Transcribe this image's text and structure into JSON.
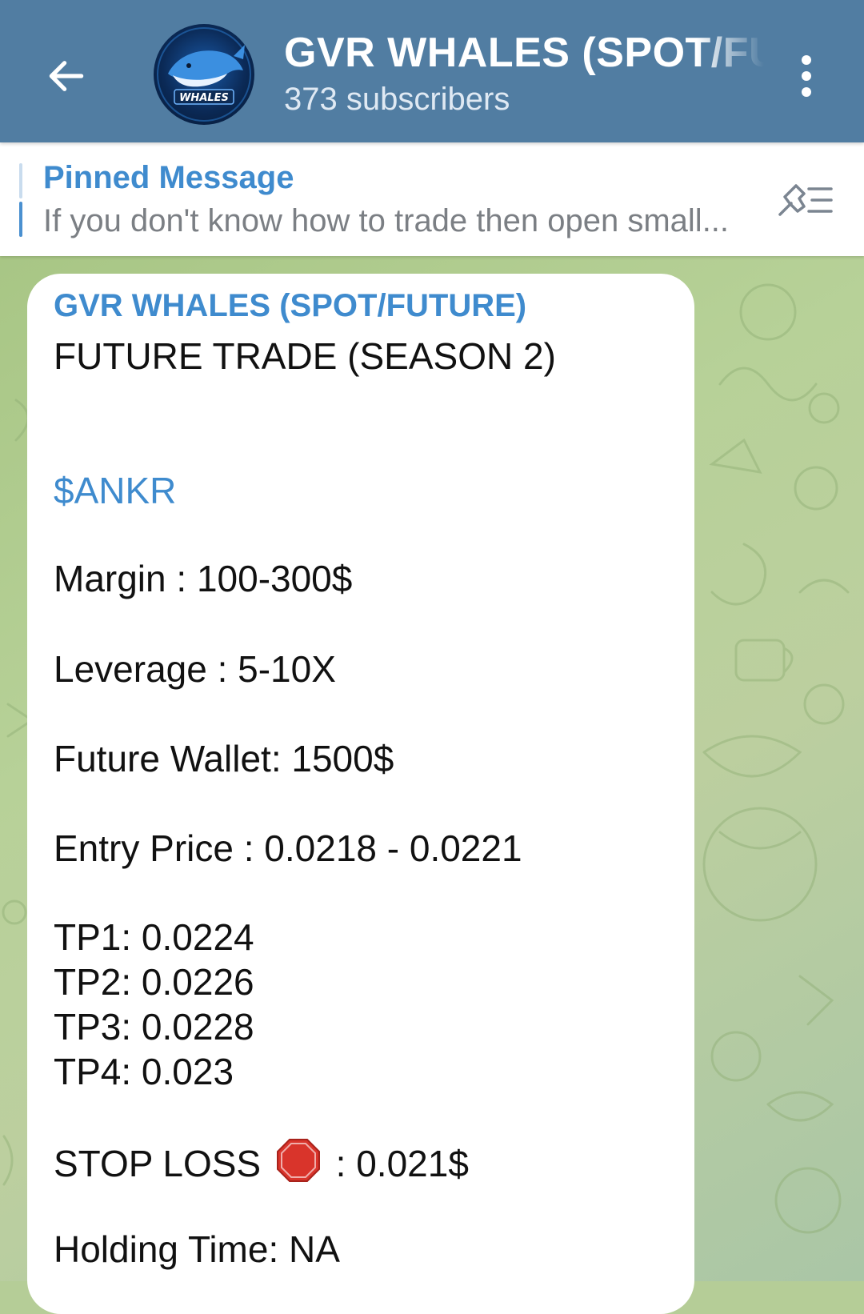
{
  "header": {
    "title": "GVR WHALES (SPOT/FUTURE)",
    "subtitle": "373 subscribers",
    "avatar_text": "WHALES"
  },
  "pinned": {
    "title": "Pinned Message",
    "text": "If you don't know how to trade then open small..."
  },
  "message": {
    "sender": "GVR WHALES (SPOT/FUTURE)",
    "heading": "FUTURE TRADE (SEASON 2)",
    "ticker": "$ANKR",
    "margin": "Margin : 100-300$",
    "leverage": "Leverage : 5-10X",
    "wallet": "Future Wallet: 1500$",
    "entry": "Entry Price : 0.0218 - 0.0221",
    "tp1": "TP1: 0.0224",
    "tp2": "TP2: 0.0226",
    "tp3": "TP3: 0.0228",
    "tp4": "TP4: 0.023",
    "stop_loss_label": "STOP LOSS",
    "stop_loss_value": ": 0.021$",
    "holding": "Holding Time: NA"
  },
  "icons": {
    "back": "arrow-left-icon",
    "menu": "more-vertical-icon",
    "pinned_list": "pin-list-icon",
    "stop": "stop-sign-icon"
  },
  "colors": {
    "header_bg": "#517da2",
    "accent_blue": "#3f8bce",
    "chat_bg": "#b5cd97",
    "stop_red": "#d9342b"
  }
}
